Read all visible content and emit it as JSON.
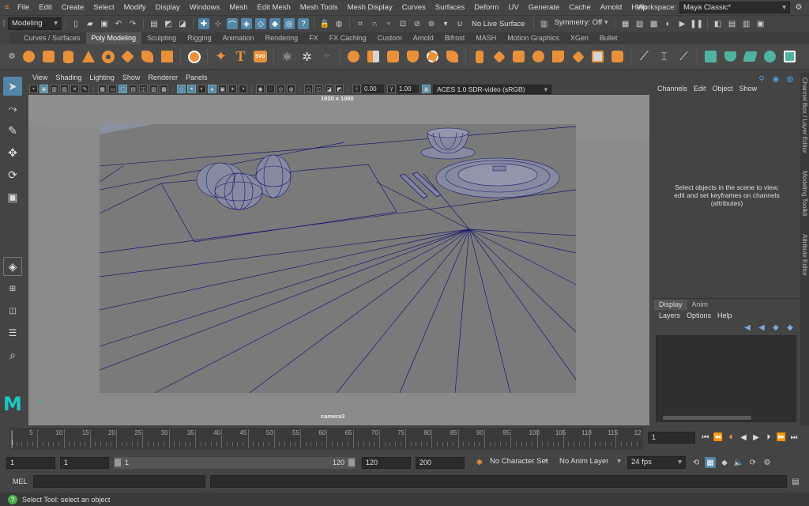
{
  "menus": [
    "File",
    "Edit",
    "Create",
    "Select",
    "Modify",
    "Display",
    "Windows",
    "Mesh",
    "Edit Mesh",
    "Mesh Tools",
    "Mesh Display",
    "Curves",
    "Surfaces",
    "Deform",
    "UV",
    "Generate",
    "Cache",
    "Arnold",
    "Help"
  ],
  "workspace": {
    "label": "Workspace:",
    "value": "Maya Classic*"
  },
  "status": {
    "menu_set": "Modeling",
    "live_surface": "No Live Surface",
    "symmetry": "Symmetry: Off"
  },
  "shelf_tabs": [
    "Curves / Surfaces",
    "Poly Modeling",
    "Sculpting",
    "Rigging",
    "Animation",
    "Rendering",
    "FX",
    "FX Caching",
    "Custom",
    "Arnold",
    "Bifrost",
    "MASH",
    "Motion Graphics",
    "XGen",
    "Bullet"
  ],
  "active_shelf_tab": "Poly Modeling",
  "shelf_text_icon": "T",
  "shelf_svg_icon": "SVG",
  "panel_menu": [
    "View",
    "Shading",
    "Lighting",
    "Show",
    "Renderer",
    "Panels"
  ],
  "panel_tools": {
    "exposure": "0.00",
    "gamma": "1.00",
    "color_space": "ACES 1.0 SDR-video (sRGB)"
  },
  "viewport": {
    "resolution": "1920 x 1080",
    "camera": "camera3"
  },
  "channel_box": {
    "menus": [
      "Channels",
      "Edit",
      "Object",
      "Show"
    ],
    "message": "Select objects in the scene to view, edit and set keyframes on channels (attributes)"
  },
  "side_tabs": [
    "Channel Box / Layer Editor",
    "Modeling Toolkit",
    "Attribute Editor"
  ],
  "layer_editor": {
    "tabs": [
      "Display",
      "Anim"
    ],
    "menus": [
      "Layers",
      "Options",
      "Help"
    ]
  },
  "timeline": {
    "ticks": [
      "5",
      "10",
      "15",
      "20",
      "25",
      "30",
      "35",
      "40",
      "45",
      "50",
      "55",
      "60",
      "65",
      "70",
      "75",
      "80",
      "85",
      "90",
      "95",
      "100",
      "105",
      "110",
      "115",
      "12"
    ],
    "current_frame": "1",
    "start_marker": "1"
  },
  "range": {
    "start": "1",
    "anim_start": "1",
    "slider_start": "1",
    "slider_end": "120",
    "end": "120",
    "anim_end": "200",
    "character_set": "No Character Set",
    "anim_layer": "No Anim Layer",
    "fps": "24 fps"
  },
  "mel": {
    "label": "MEL"
  },
  "help_line": "Select Tool: select an object",
  "colors": {
    "accent": "#5285a6",
    "shelf_orange": "#e8913a",
    "wire": "#1c1c6e",
    "viewport_bg": "#8a8a8a",
    "maya_logo": "#1bc7c2"
  }
}
